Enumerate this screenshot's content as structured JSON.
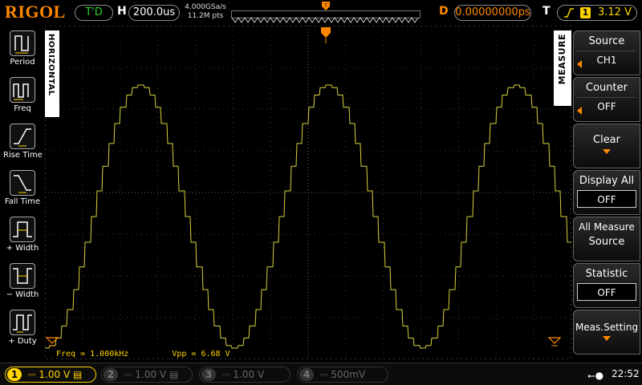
{
  "colors": {
    "accent": "#ff8800",
    "ch1": "#ffd400",
    "status": "#2fd12f"
  },
  "topbar": {
    "logo": "RIGOL",
    "trigger_status": "T'D",
    "h_label": "H",
    "timebase": "200.0us",
    "sample_rate": "4.000GSa/s",
    "memory_depth": "11.2M pts",
    "d_label": "D",
    "delay": "0.00000000ps",
    "t_label": "T",
    "trigger_edge_icon": "rising-edge-icon",
    "trigger_source": "1",
    "trigger_level": "3.12 V"
  },
  "left_menu": {
    "tab": "HORIZONTAL",
    "items": [
      {
        "label": "Period",
        "icon": "period-icon"
      },
      {
        "label": "Freq",
        "icon": "freq-icon"
      },
      {
        "label": "Rise Time",
        "icon": "rise-time-icon"
      },
      {
        "label": "Fall Time",
        "icon": "fall-time-icon"
      },
      {
        "label": "+ Width",
        "icon": "positive-width-icon"
      },
      {
        "label": "− Width",
        "icon": "negative-width-icon"
      },
      {
        "label": "+ Duty",
        "icon": "positive-duty-icon"
      }
    ]
  },
  "right_menu": {
    "tab": "MEASURE",
    "source_label": "Source",
    "source_value": "CH1",
    "counter_label": "Counter",
    "counter_value": "OFF",
    "clear_label": "Clear",
    "display_all_label": "Display All",
    "display_all_value": "OFF",
    "all_measure_label": "All Measure",
    "all_measure_sub": "Source",
    "statistic_label": "Statistic",
    "statistic_value": "OFF",
    "meas_setting_label": "Meas.Setting"
  },
  "measurements": {
    "freq": "Freq = 1.000kHz",
    "vpp": "Vpp = 6.68 V"
  },
  "waveform": {
    "channel": 1,
    "frequency_khz": 1.0,
    "vpp_volts": 6.68
  },
  "channels": [
    {
      "num": "1",
      "scale": "1.00 V",
      "active": true
    },
    {
      "num": "2",
      "scale": "1.00 V",
      "active": false
    },
    {
      "num": "3",
      "scale": "1.00 V",
      "active": false
    },
    {
      "num": "4",
      "scale": "500mV",
      "active": false
    }
  ],
  "status": {
    "usb_icon": "usb-icon",
    "time": "22:52"
  }
}
